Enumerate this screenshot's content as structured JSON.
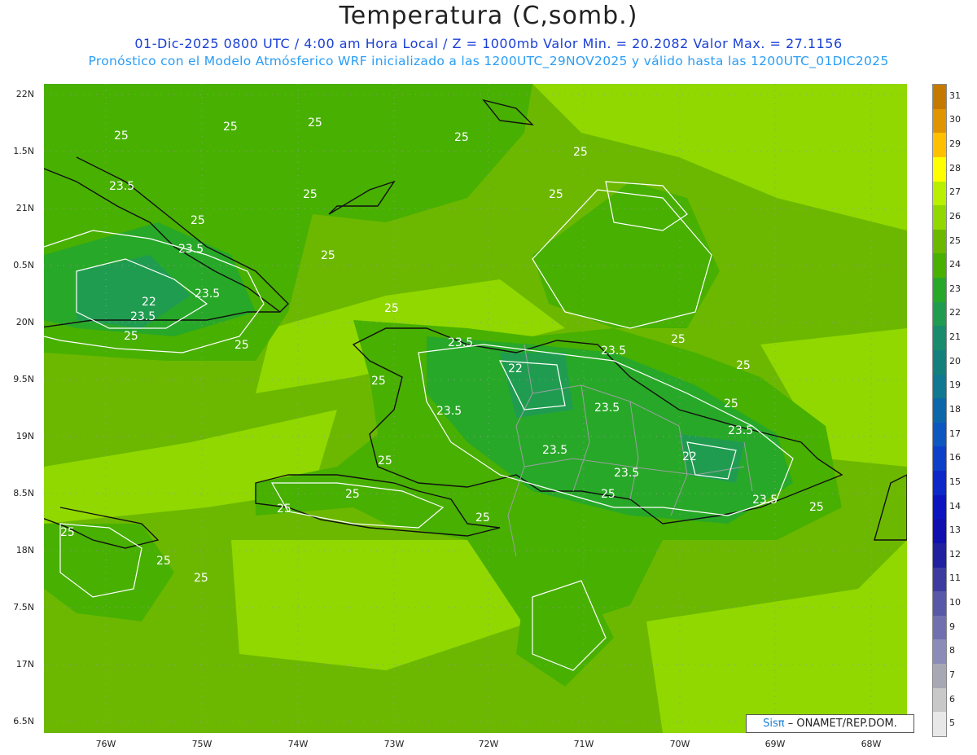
{
  "header": {
    "title": "Temperatura (C,somb.)",
    "line1": "01-Dic-2025  0800 UTC / 4:00 am Hora Local / Z = 1000mb   Valor Min. = 20.2082  Valor Max. = 27.1156",
    "line2": "Pronóstico con el Modelo Atmósferico WRF inicializado a las 1200UTC_29NOV2025 y válido hasta las  1200UTC_01DIC2025"
  },
  "axes": {
    "lat_labels": [
      "22N",
      "1.5N",
      "21N",
      "0.5N",
      "20N",
      "9.5N",
      "19N",
      "8.5N",
      "18N",
      "7.5N",
      "17N",
      "6.5N"
    ],
    "lon_labels": [
      "76W",
      "75W",
      "74W",
      "73W",
      "72W",
      "71W",
      "70W",
      "69W",
      "68W"
    ]
  },
  "colorbar": {
    "labels": [
      "31",
      "30",
      "29",
      "28",
      "27",
      "26",
      "25",
      "24",
      "23",
      "22",
      "21",
      "20",
      "19",
      "18",
      "17",
      "16",
      "15",
      "14",
      "13",
      "12",
      "11",
      "10",
      "9",
      "8",
      "7",
      "6",
      "5"
    ],
    "colors": [
      "#c47a00",
      "#e09400",
      "#ffc000",
      "#ffff00",
      "#b8f000",
      "#90d800",
      "#6cb800",
      "#48b000",
      "#28a828",
      "#209c50",
      "#188c6c",
      "#14807c",
      "#107890",
      "#0c68a8",
      "#0c58c0",
      "#0c40c8",
      "#0c28c8",
      "#0c14c0",
      "#1010b0",
      "#2020a0",
      "#3c3ca0",
      "#5858a8",
      "#7070b0",
      "#8c8cb8",
      "#a8a8b4",
      "#c8c8c8",
      "#e8e8e8"
    ]
  },
  "contour_labels": [
    "25",
    "25",
    "25",
    "25",
    "25",
    "25",
    "23.5",
    "25",
    "23.5",
    "25",
    "23.5",
    "22",
    "23.5",
    "25",
    "25",
    "25",
    "25",
    "23.5",
    "23.5",
    "22",
    "25",
    "23.5",
    "23.5",
    "23.5",
    "22",
    "23.5",
    "23.5",
    "25",
    "23.5",
    "25",
    "25",
    "25",
    "25",
    "25",
    "25",
    "25",
    "25",
    "25",
    "25",
    "25"
  ],
  "credit": {
    "brand": "Sisπ",
    "text": "– ONAMET/REP.DOM."
  }
}
